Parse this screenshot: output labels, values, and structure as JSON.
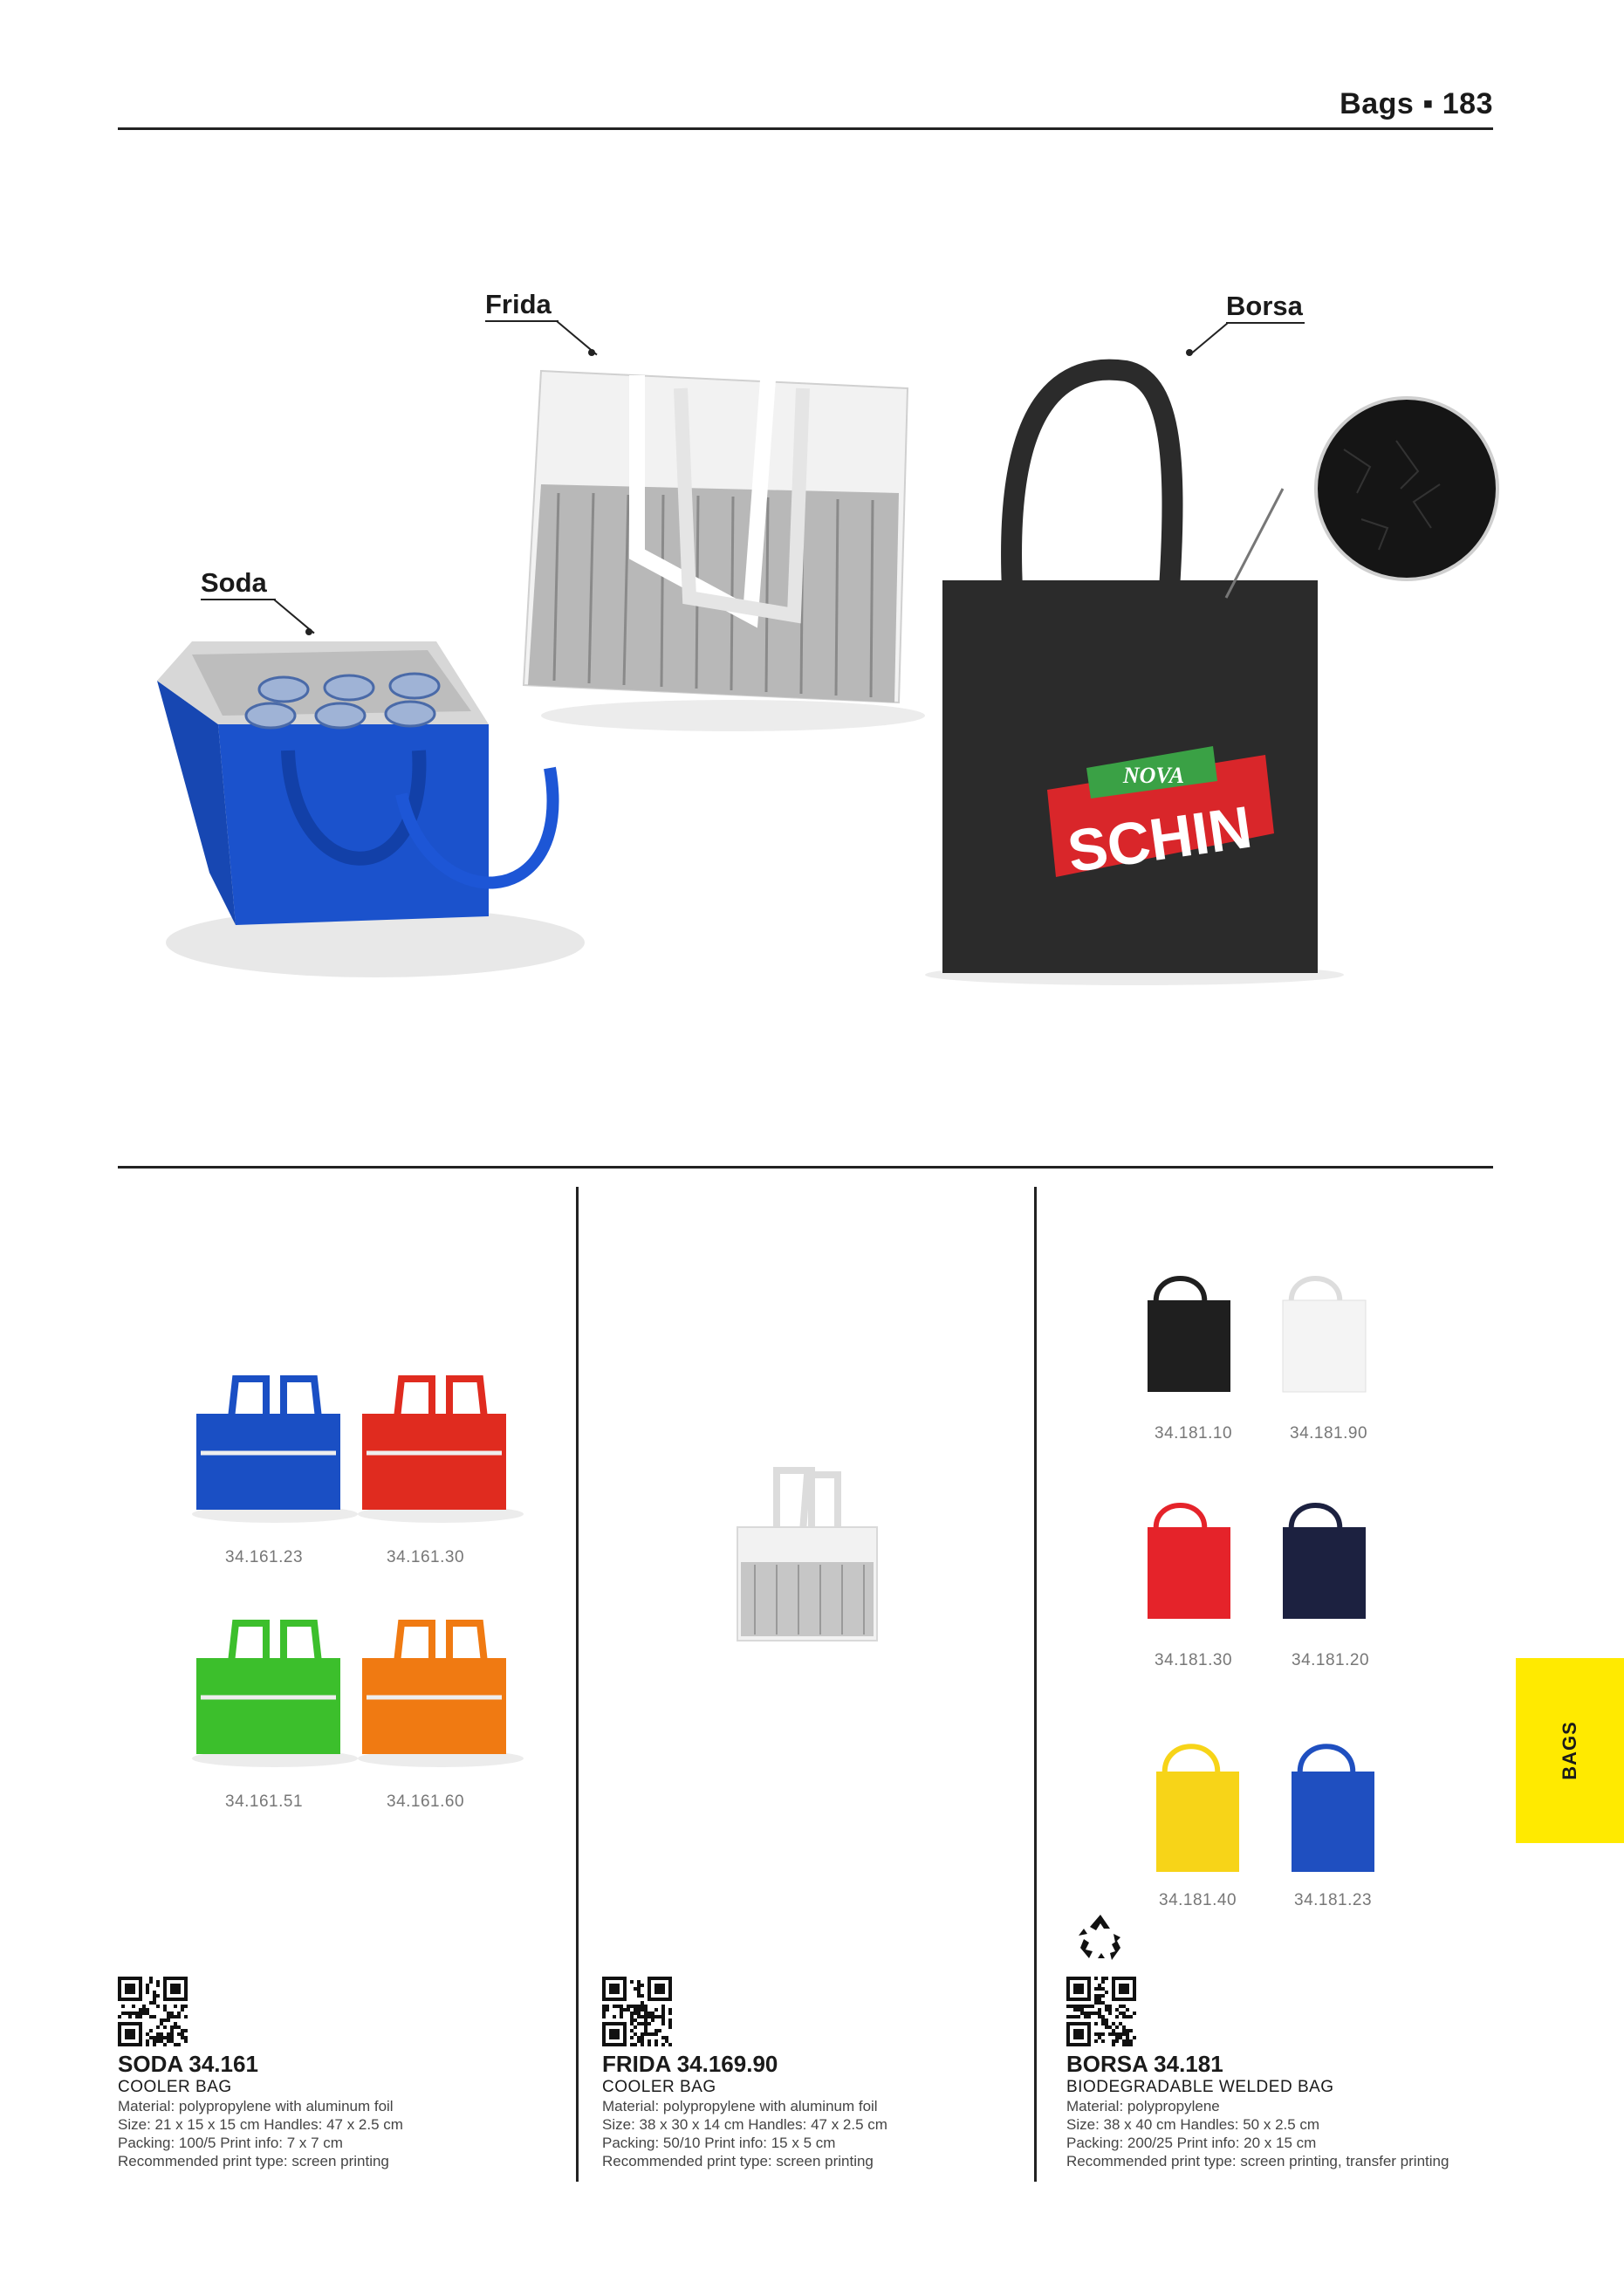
{
  "header": {
    "title": "Bags ▪ 183"
  },
  "callouts": {
    "soda": "Soda",
    "frida": "Frida",
    "borsa": "Borsa"
  },
  "hero": {
    "brand_top": "NOVA",
    "brand_main": "SCHIN"
  },
  "soda": {
    "variants": [
      "34.161.23",
      "34.161.30",
      "34.161.51",
      "34.161.60"
    ],
    "colors": [
      "#1a4fc4",
      "#e02b1f",
      "#3cbf2c",
      "#f07a12"
    ],
    "name": "SODA 34.161",
    "type": "COOLER BAG",
    "material": "Material: polypropylene with aluminum foil",
    "size": "Size: 21 x 15 x 15 cm Handles: 47 x 2.5 cm",
    "packing": "Packing: 100/5 Print info: 7 x 7 cm",
    "print": "Recommended print type: screen printing"
  },
  "frida": {
    "name": "FRIDA 34.169.90",
    "type": "COOLER BAG",
    "material": "Material: polypropylene with aluminum foil",
    "size": "Size: 38 x 30 x 14 cm Handles: 47 x 2.5 cm",
    "packing": "Packing: 50/10 Print info: 15 x 5 cm",
    "print": "Recommended print type: screen printing"
  },
  "borsa": {
    "variants": [
      "34.181.10",
      "34.181.90",
      "34.181.30",
      "34.181.20",
      "34.181.40",
      "34.181.23"
    ],
    "colors": [
      "#1f1f1f",
      "#f4f4f4",
      "#e5232a",
      "#1c2140",
      "#f7d418",
      "#1f4fc0"
    ],
    "name": "BORSA 34.181",
    "type": "BIODEGRADABLE WELDED BAG",
    "material": "Material: polypropylene",
    "size": "Size: 38 x 40 cm Handles: 50 x 2.5 cm",
    "packing": "Packing: 200/25 Print info: 20 x 15 cm",
    "print": "Recommended print type: screen printing, transfer printing"
  },
  "side_tab": {
    "label": "BAGS"
  }
}
